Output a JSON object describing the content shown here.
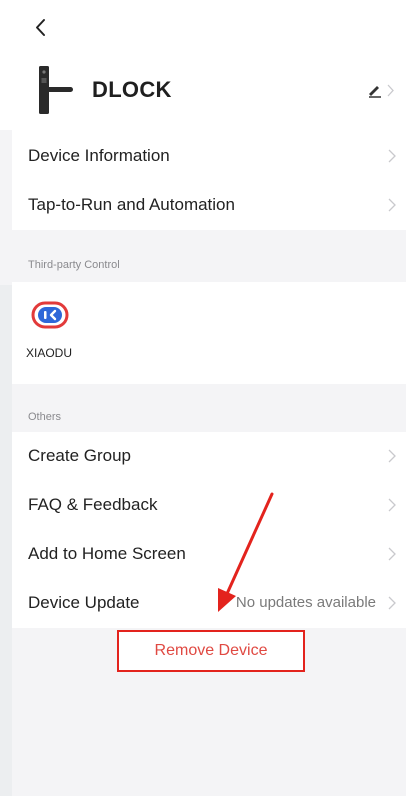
{
  "header": {
    "device_name": "DLOCK"
  },
  "main_list": {
    "items": [
      {
        "label": "Device Information"
      },
      {
        "label": "Tap-to-Run and Automation"
      }
    ]
  },
  "third_party": {
    "section_title": "Third-party Control",
    "services": [
      {
        "label": "XIAODU"
      }
    ]
  },
  "others": {
    "section_title": "Others",
    "items": [
      {
        "label": "Create Group"
      },
      {
        "label": "FAQ & Feedback"
      },
      {
        "label": "Add to Home Screen"
      },
      {
        "label": "Device Update",
        "value": "No updates available"
      }
    ]
  },
  "remove_button": {
    "label": "Remove Device"
  },
  "colors": {
    "background": "#f4f4f6",
    "annotation_red": "#e3231d",
    "remove_text": "#e04942",
    "xiaodu_blue": "#2f67d8",
    "xiaodu_red": "#e23a3a"
  }
}
